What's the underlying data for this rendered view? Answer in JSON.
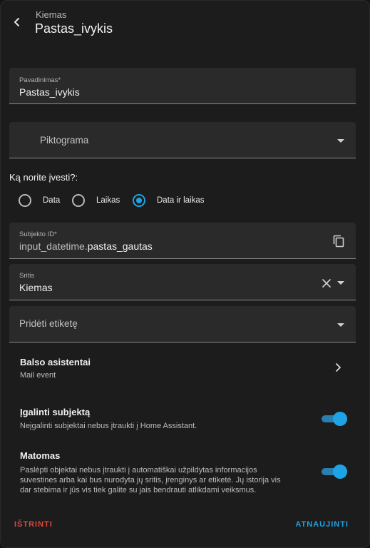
{
  "header": {
    "subtitle": "Kiemas",
    "title": "Pastas_ivykis",
    "back_icon": "arrow-left-icon"
  },
  "name_field": {
    "label": "Pavadinimas*",
    "value": "Pastas_ivykis"
  },
  "icon_field": {
    "placeholder": "Piktograma",
    "icon": "chevron-down-icon"
  },
  "input_type": {
    "question": "Ką norite įvesti?:",
    "options": [
      {
        "label": "Data",
        "checked": false
      },
      {
        "label": "Laikas",
        "checked": false
      },
      {
        "label": "Data ir laikas",
        "checked": true
      }
    ]
  },
  "entity_id_field": {
    "label": "Subjekto ID*",
    "prefix": "input_datetime.",
    "value": "pastas_gautas",
    "icon": "copy-icon"
  },
  "area_field": {
    "label": "Sritis",
    "value": "Kiemas",
    "icons": [
      "close-icon",
      "chevron-down-icon"
    ]
  },
  "labels_field": {
    "placeholder": "Pridėti etiketę"
  },
  "voice_assistants": {
    "title": "Balso asistentai",
    "subtitle": "Mail event",
    "icon": "chevron-right-icon"
  },
  "enable_entity": {
    "title": "Įgalinti subjektą",
    "description": "Neįgalinti subjektai nebus įtraukti į Home Assistant.",
    "enabled": true
  },
  "visible": {
    "title": "Matomas",
    "description": "Paslėpti objektai nebus įtraukti į automatiškai užpildytas informacijos suvestines arba kai bus nurodyta jų sritis, įrenginys ar etiketė. Jų istorija vis dar stebima ir jūs vis tiek galite su jais bendrauti atlikdami veiksmus.",
    "enabled": true
  },
  "actions": {
    "delete_label": "IŠTRINTI",
    "update_label": "ATNAUJINTI"
  },
  "colors": {
    "accent": "#1ea4e6",
    "danger": "#e0463e",
    "background": "#1c1c1c",
    "field": "#2a2a2a"
  }
}
